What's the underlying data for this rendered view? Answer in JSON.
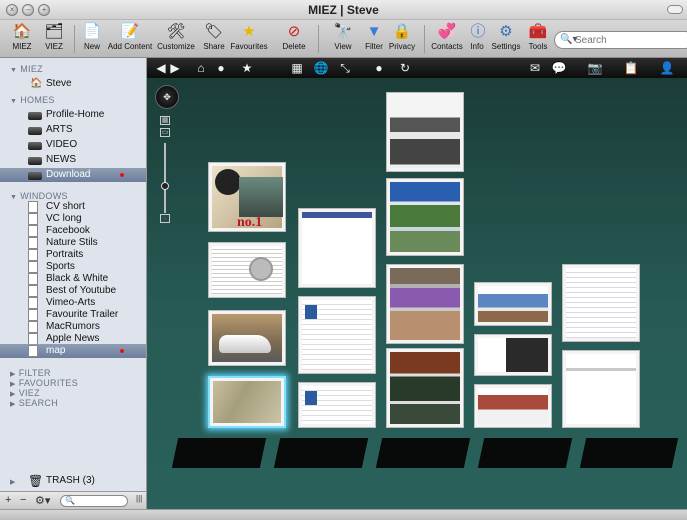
{
  "window": {
    "title": "MIEZ | Steve"
  },
  "toolbar": {
    "items": [
      {
        "label": "MIEZ",
        "icon": "house-icon"
      },
      {
        "label": "VIEZ",
        "icon": "viez-icon"
      },
      {
        "label": "New",
        "icon": "new-document-icon"
      },
      {
        "label": "Add Content",
        "icon": "add-content-icon"
      },
      {
        "label": "Customize",
        "icon": "tools-customize-icon"
      },
      {
        "label": "Share",
        "icon": "share-tag-icon"
      },
      {
        "label": "Favourites",
        "icon": "star-icon"
      },
      {
        "label": "Delete",
        "icon": "no-sign-icon"
      },
      {
        "label": "View",
        "icon": "binoculars-icon"
      },
      {
        "label": "Filter",
        "icon": "filter-funnel-icon"
      },
      {
        "label": "Privacy",
        "icon": "lock-icon"
      },
      {
        "label": "Contacts",
        "icon": "contacts-icon"
      },
      {
        "label": "Info",
        "icon": "info-icon"
      },
      {
        "label": "Settings",
        "icon": "gear-icon"
      },
      {
        "label": "Tools",
        "icon": "tools-icon"
      }
    ],
    "search_placeholder": "Search"
  },
  "sidebar": {
    "miez_header": "MIEZ",
    "miez_items": [
      {
        "label": "Steve"
      }
    ],
    "homes_header": "HOMES",
    "homes_items": [
      {
        "label": "Profile-Home"
      },
      {
        "label": "ARTS"
      },
      {
        "label": "VIDEO"
      },
      {
        "label": "NEWS"
      },
      {
        "label": "Download",
        "selected": true,
        "badge": true
      }
    ],
    "windows_header": "WINDOWS",
    "windows_items": [
      {
        "label": "CV short"
      },
      {
        "label": "VC long"
      },
      {
        "label": "Facebook"
      },
      {
        "label": "Nature Stils"
      },
      {
        "label": "Portraits"
      },
      {
        "label": "Sports"
      },
      {
        "label": "Black & White"
      },
      {
        "label": "Best of Youtube"
      },
      {
        "label": "Vimeo-Arts"
      },
      {
        "label": "Favourite Trailer"
      },
      {
        "label": "MacRumors"
      },
      {
        "label": "Apple News"
      },
      {
        "label": "map",
        "selected": true,
        "badge": true
      }
    ],
    "collapsed_sections": [
      "FILTER",
      "FAVOURITES",
      "VIEZ",
      "SEARCH"
    ],
    "trash_label": "TRASH (3)"
  },
  "viewer": {
    "album_label": "no.1",
    "accent_color": "#7fe0ff",
    "background_color": "#275a54"
  }
}
